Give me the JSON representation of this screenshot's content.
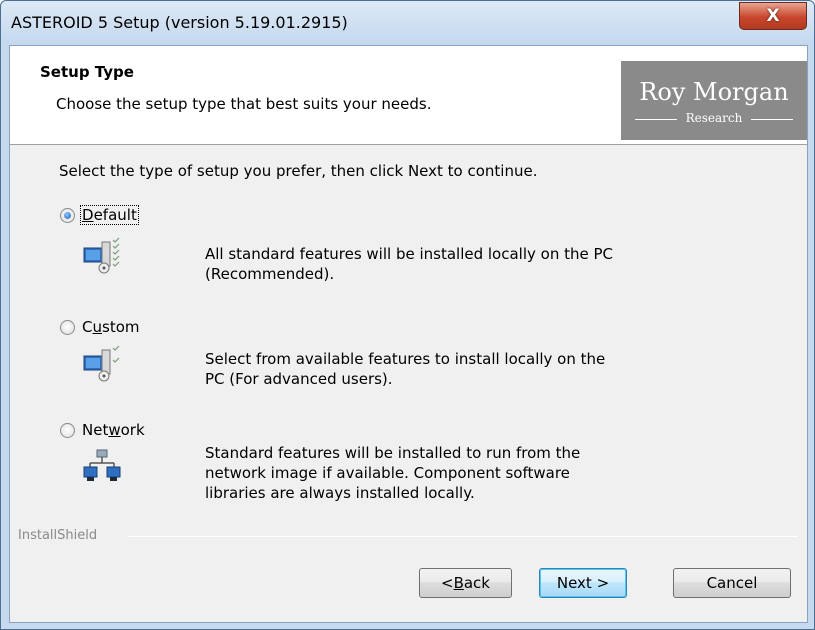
{
  "window": {
    "title": "ASTEROID 5 Setup (version 5.19.01.2915)",
    "close_label": "X"
  },
  "header": {
    "title": "Setup Type",
    "subtitle": "Choose the setup type that best suits your needs.",
    "logo_main": "Roy Morgan",
    "logo_sub": "Research"
  },
  "body": {
    "intro": "Select the type of setup you prefer, then click Next to continue.",
    "options": [
      {
        "label_pre": "",
        "label_ul": "D",
        "label_post": "efault",
        "icon": "computer-install-all-icon",
        "description_lines": [
          "All standard features will be installed locally on the PC",
          "(Recommended)."
        ],
        "selected": true
      },
      {
        "label_pre": "C",
        "label_ul": "u",
        "label_post": "stom",
        "icon": "computer-install-custom-icon",
        "description_lines": [
          "Select from available features to install locally on the",
          "PC (For advanced users)."
        ],
        "selected": false
      },
      {
        "label_pre": "Net",
        "label_ul": "w",
        "label_post": "ork",
        "icon": "network-computers-icon",
        "description_lines": [
          "Standard features will be installed to run from the",
          "network image if available.  Component software",
          "libraries are always installed locally."
        ],
        "selected": false
      }
    ]
  },
  "branding": "InstallShield",
  "buttons": {
    "back_pre": "< ",
    "back_ul": "B",
    "back_post": "ack",
    "next": "Next >",
    "cancel": "Cancel"
  },
  "colors": {
    "title_bar": "#c6d9ee",
    "close_button": "#c8462d",
    "logo_background": "#8a8a8a",
    "dialog_background": "#f0f0f0",
    "default_button_border": "#3c7fb1"
  }
}
